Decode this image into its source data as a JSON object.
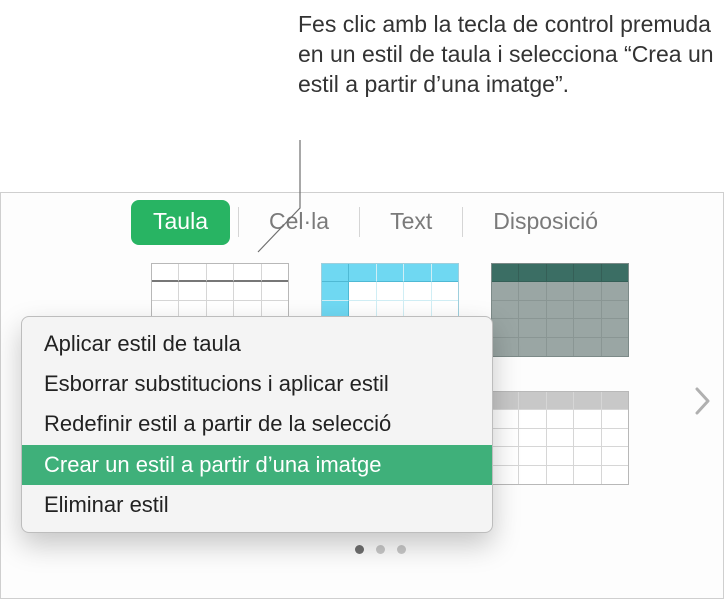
{
  "callout": {
    "text": "Fes clic amb la tecla de control premuda en un estil de taula i selecciona “Crea un estil a partir d’una imatge”."
  },
  "tabs": {
    "taula": "Taula",
    "cel_la": "Cel·la",
    "text": "Text",
    "disposicio": "Disposició"
  },
  "styles": {
    "thumb1": "table-style-white",
    "thumb2": "table-style-cyan",
    "thumb3": "table-style-teal",
    "thumb4": "table-style-grey-header"
  },
  "menu": {
    "apply": "Aplicar estil de taula",
    "clear": "Esborrar substitucions i aplicar estil",
    "redefine": "Redefinir estil a partir de la selecció",
    "create_image": "Crear un estil a partir d’una imatge",
    "delete": "Eliminar estil"
  },
  "colors": {
    "accent": "#28b463",
    "menu_highlight": "#3fb07a"
  }
}
